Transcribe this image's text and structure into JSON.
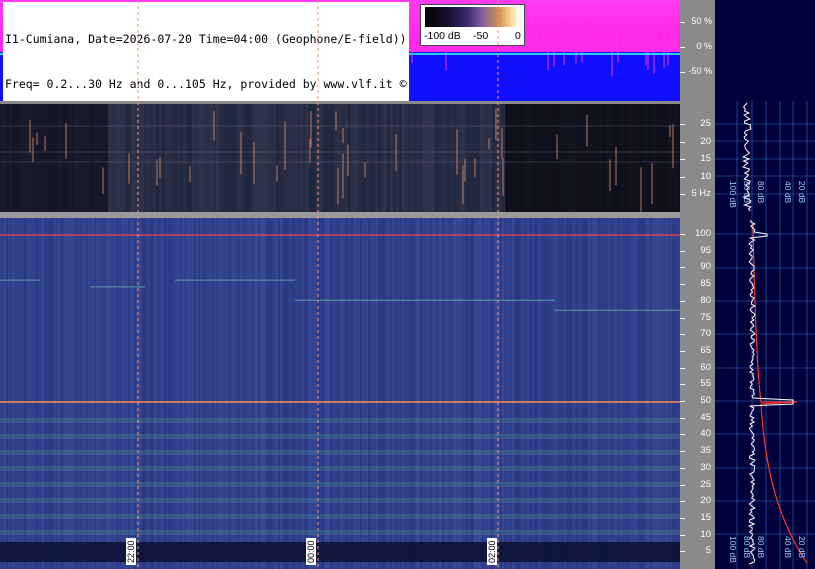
{
  "header": {
    "line1": "I1-Cumiana, Date=2026-07-20 Time=04:00 (Geophone/E-field))",
    "line2": "Freq= 0.2...30 Hz and 0...105 Hz, provided by www.vlf.it ©"
  },
  "colorbar": {
    "labels": [
      "-100 dB",
      "-50",
      "0"
    ]
  },
  "amplitude_scale": {
    "labels": [
      "50 %",
      "0 %",
      "-50 %"
    ]
  },
  "geophone_scale": {
    "labels": [
      "25",
      "20",
      "15",
      "10",
      "5 Hz"
    ]
  },
  "efield_scale": {
    "labels": [
      "100",
      "95",
      "90",
      "85",
      "80",
      "75",
      "70",
      "65",
      "60",
      "55",
      "50",
      "45",
      "40",
      "35",
      "30",
      "25",
      "20",
      "15",
      "10",
      "5"
    ]
  },
  "spectrum_top_labels": [
    "100 dB",
    "80 dB",
    "40 dB",
    "20 dB"
  ],
  "spectrum_main_labels": [
    "100 dB",
    "80 dB",
    "40 dB",
    "20 dB"
  ],
  "time_markers": [
    "22:00",
    "00:00",
    "02:00"
  ],
  "colors": {
    "amplitude_bg": "#1010ff",
    "amplitude_signal": "#ff1ee6",
    "spectrum_bg": "#00003a",
    "scale_bg": "#8a8a8a",
    "mains_line": "#ff4040"
  }
}
